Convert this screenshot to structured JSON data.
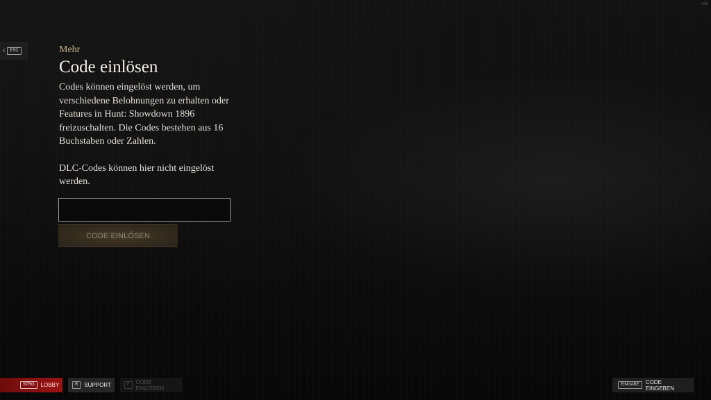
{
  "version": "v54",
  "esc": {
    "key": "ESC"
  },
  "breadcrumb": "Mehr",
  "title": "Code einlösen",
  "description": "Codes können eingelöst werden, um verschiedene Belohnungen zu erhalten oder Features in Hunt: Showdown 1896 freizuschalten. Die Codes bestehen aus 16 Buchstaben oder Zahlen.",
  "note": "DLC-Codes können hier nicht eingelöst werden.",
  "code_input": {
    "value": "",
    "placeholder": ""
  },
  "redeem_button": "CODE EINLÖSEN",
  "footer": {
    "lobby": {
      "key": "STRG",
      "label": "LOBBY"
    },
    "support": {
      "key": "R",
      "label": "SUPPORT"
    },
    "redeem": {
      "key": "F",
      "label": "CODE EINLÖSEN"
    },
    "enter": {
      "key": "EINGABE",
      "label": "CODE EINGEBEN"
    }
  },
  "colors": {
    "accent_gold": "#c7b48a",
    "lobby_red": "#9b1313",
    "background": "#0b0b0b"
  }
}
